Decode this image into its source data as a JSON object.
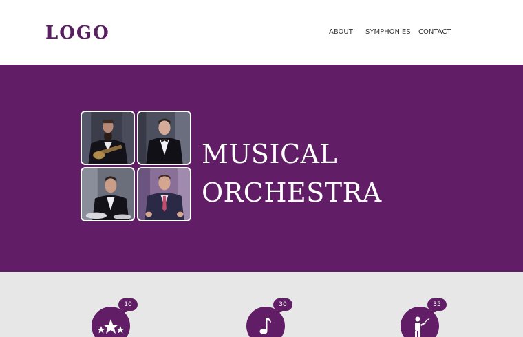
{
  "header": {
    "logo": "LOGO",
    "nav": [
      {
        "label": "ABOUT"
      },
      {
        "label": "SYMPHONIES"
      },
      {
        "label": "CONTACT"
      }
    ]
  },
  "hero": {
    "title_line1": "MUSICAL",
    "title_line2": "ORCHESTRA",
    "photos": [
      {
        "icon": "guitarist-photo"
      },
      {
        "icon": "singer-photo"
      },
      {
        "icon": "drummer-photo"
      },
      {
        "icon": "man-in-suit-photo"
      }
    ]
  },
  "stats": [
    {
      "count": "10",
      "icon": "stars-icon"
    },
    {
      "count": "30",
      "icon": "music-note-icon"
    },
    {
      "count": "35",
      "icon": "conductor-icon"
    }
  ],
  "colors": {
    "brand": "#611e66",
    "logo": "#5a1f63",
    "stats_background": "#e8e7e8"
  }
}
